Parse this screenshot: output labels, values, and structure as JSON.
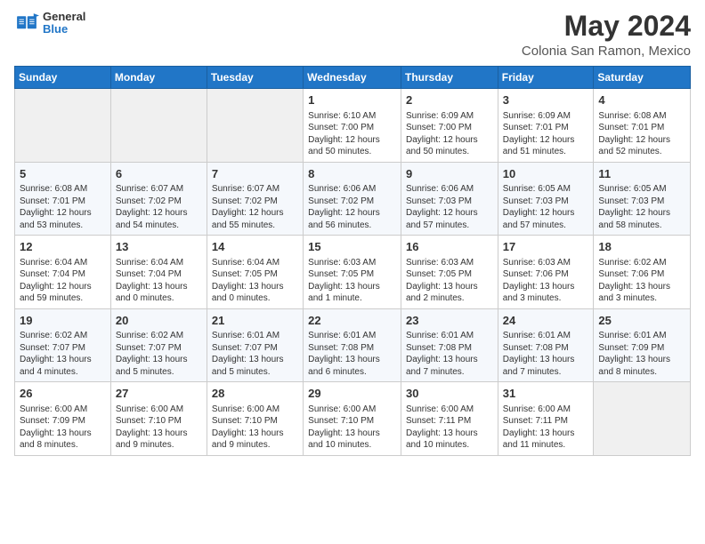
{
  "logo": {
    "general": "General",
    "blue": "Blue"
  },
  "title": {
    "month_year": "May 2024",
    "location": "Colonia San Ramon, Mexico"
  },
  "days_of_week": [
    "Sunday",
    "Monday",
    "Tuesday",
    "Wednesday",
    "Thursday",
    "Friday",
    "Saturday"
  ],
  "weeks": [
    [
      {
        "day": "",
        "info": ""
      },
      {
        "day": "",
        "info": ""
      },
      {
        "day": "",
        "info": ""
      },
      {
        "day": "1",
        "info": "Sunrise: 6:10 AM\nSunset: 7:00 PM\nDaylight: 12 hours and 50 minutes."
      },
      {
        "day": "2",
        "info": "Sunrise: 6:09 AM\nSunset: 7:00 PM\nDaylight: 12 hours and 50 minutes."
      },
      {
        "day": "3",
        "info": "Sunrise: 6:09 AM\nSunset: 7:01 PM\nDaylight: 12 hours and 51 minutes."
      },
      {
        "day": "4",
        "info": "Sunrise: 6:08 AM\nSunset: 7:01 PM\nDaylight: 12 hours and 52 minutes."
      }
    ],
    [
      {
        "day": "5",
        "info": "Sunrise: 6:08 AM\nSunset: 7:01 PM\nDaylight: 12 hours and 53 minutes."
      },
      {
        "day": "6",
        "info": "Sunrise: 6:07 AM\nSunset: 7:02 PM\nDaylight: 12 hours and 54 minutes."
      },
      {
        "day": "7",
        "info": "Sunrise: 6:07 AM\nSunset: 7:02 PM\nDaylight: 12 hours and 55 minutes."
      },
      {
        "day": "8",
        "info": "Sunrise: 6:06 AM\nSunset: 7:02 PM\nDaylight: 12 hours and 56 minutes."
      },
      {
        "day": "9",
        "info": "Sunrise: 6:06 AM\nSunset: 7:03 PM\nDaylight: 12 hours and 57 minutes."
      },
      {
        "day": "10",
        "info": "Sunrise: 6:05 AM\nSunset: 7:03 PM\nDaylight: 12 hours and 57 minutes."
      },
      {
        "day": "11",
        "info": "Sunrise: 6:05 AM\nSunset: 7:03 PM\nDaylight: 12 hours and 58 minutes."
      }
    ],
    [
      {
        "day": "12",
        "info": "Sunrise: 6:04 AM\nSunset: 7:04 PM\nDaylight: 12 hours and 59 minutes."
      },
      {
        "day": "13",
        "info": "Sunrise: 6:04 AM\nSunset: 7:04 PM\nDaylight: 13 hours and 0 minutes."
      },
      {
        "day": "14",
        "info": "Sunrise: 6:04 AM\nSunset: 7:05 PM\nDaylight: 13 hours and 0 minutes."
      },
      {
        "day": "15",
        "info": "Sunrise: 6:03 AM\nSunset: 7:05 PM\nDaylight: 13 hours and 1 minute."
      },
      {
        "day": "16",
        "info": "Sunrise: 6:03 AM\nSunset: 7:05 PM\nDaylight: 13 hours and 2 minutes."
      },
      {
        "day": "17",
        "info": "Sunrise: 6:03 AM\nSunset: 7:06 PM\nDaylight: 13 hours and 3 minutes."
      },
      {
        "day": "18",
        "info": "Sunrise: 6:02 AM\nSunset: 7:06 PM\nDaylight: 13 hours and 3 minutes."
      }
    ],
    [
      {
        "day": "19",
        "info": "Sunrise: 6:02 AM\nSunset: 7:07 PM\nDaylight: 13 hours and 4 minutes."
      },
      {
        "day": "20",
        "info": "Sunrise: 6:02 AM\nSunset: 7:07 PM\nDaylight: 13 hours and 5 minutes."
      },
      {
        "day": "21",
        "info": "Sunrise: 6:01 AM\nSunset: 7:07 PM\nDaylight: 13 hours and 5 minutes."
      },
      {
        "day": "22",
        "info": "Sunrise: 6:01 AM\nSunset: 7:08 PM\nDaylight: 13 hours and 6 minutes."
      },
      {
        "day": "23",
        "info": "Sunrise: 6:01 AM\nSunset: 7:08 PM\nDaylight: 13 hours and 7 minutes."
      },
      {
        "day": "24",
        "info": "Sunrise: 6:01 AM\nSunset: 7:08 PM\nDaylight: 13 hours and 7 minutes."
      },
      {
        "day": "25",
        "info": "Sunrise: 6:01 AM\nSunset: 7:09 PM\nDaylight: 13 hours and 8 minutes."
      }
    ],
    [
      {
        "day": "26",
        "info": "Sunrise: 6:00 AM\nSunset: 7:09 PM\nDaylight: 13 hours and 8 minutes."
      },
      {
        "day": "27",
        "info": "Sunrise: 6:00 AM\nSunset: 7:10 PM\nDaylight: 13 hours and 9 minutes."
      },
      {
        "day": "28",
        "info": "Sunrise: 6:00 AM\nSunset: 7:10 PM\nDaylight: 13 hours and 9 minutes."
      },
      {
        "day": "29",
        "info": "Sunrise: 6:00 AM\nSunset: 7:10 PM\nDaylight: 13 hours and 10 minutes."
      },
      {
        "day": "30",
        "info": "Sunrise: 6:00 AM\nSunset: 7:11 PM\nDaylight: 13 hours and 10 minutes."
      },
      {
        "day": "31",
        "info": "Sunrise: 6:00 AM\nSunset: 7:11 PM\nDaylight: 13 hours and 11 minutes."
      },
      {
        "day": "",
        "info": ""
      }
    ]
  ]
}
